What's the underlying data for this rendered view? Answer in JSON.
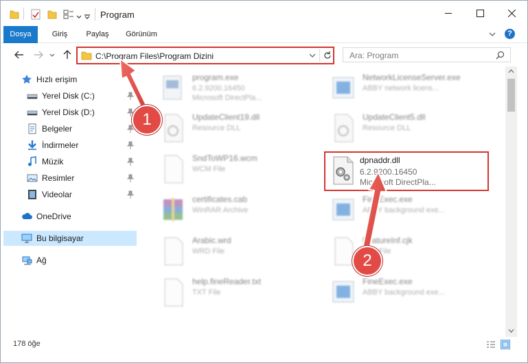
{
  "window": {
    "title": "Program",
    "controls": [
      "minimize-icon",
      "maximize-icon",
      "close-icon"
    ]
  },
  "ribbon": {
    "tabs": [
      {
        "label": "Dosya",
        "active": true
      },
      {
        "label": "Giriş"
      },
      {
        "label": "Paylaş"
      },
      {
        "label": "Görünüm"
      }
    ],
    "help_label": "?"
  },
  "nav": {
    "address": "C:\\Program Files\\Program Dizini",
    "search_placeholder": "Ara: Program"
  },
  "sidebar": {
    "items": [
      {
        "label": "Hızlı erişim",
        "icon": "star-icon"
      },
      {
        "label": "Yerel Disk (C:)",
        "icon": "drive-icon",
        "pinned": true
      },
      {
        "label": "Yerel Disk (D:)",
        "icon": "drive-icon",
        "pinned": true
      },
      {
        "label": "Belgeler",
        "icon": "documents-icon",
        "pinned": true
      },
      {
        "label": "İndirmeler",
        "icon": "download-icon",
        "pinned": true
      },
      {
        "label": "Müzik",
        "icon": "music-icon",
        "pinned": true
      },
      {
        "label": "Resimler",
        "icon": "pictures-icon",
        "pinned": true
      },
      {
        "label": "Videolar",
        "icon": "videos-icon",
        "pinned": true
      },
      {
        "label": "OneDrive",
        "icon": "cloud-icon"
      },
      {
        "label": "Bu bilgisayar",
        "icon": "computer-icon",
        "selected": true
      },
      {
        "label": "Ağ",
        "icon": "network-icon"
      }
    ]
  },
  "files": [
    {
      "name": "program.exe",
      "line2": "6.2.9200.16450",
      "line3": "Microsoft DirectPla...",
      "icon": "exe-icon"
    },
    {
      "name": "NetworkLicenseServer.exe",
      "line2": "ABBY network licens...",
      "line3": "",
      "icon": "app-blue-icon"
    },
    {
      "name": "UpdateClient19.dll",
      "line2": "Resource DLL",
      "line3": "",
      "icon": "dll-icon"
    },
    {
      "name": "UpdateClient5.dll",
      "line2": "Resource DLL",
      "line3": "",
      "icon": "dll-icon"
    },
    {
      "name": "SndToWP16.wcm",
      "line2": "WCM File",
      "line3": "",
      "icon": "blank-file-icon"
    },
    {
      "name": "dpnaddr.dll",
      "line2": "6.2.9200.16450",
      "line3": "Microsoft DirectPla...",
      "icon": "dll-gear-icon",
      "highlighted": true
    },
    {
      "name": "certificates.cab",
      "line2": "WinRAR Archive",
      "line3": "",
      "icon": "archive-icon"
    },
    {
      "name": "FineExec.exe",
      "line2": "ABBY background exe...",
      "line3": "",
      "icon": "app-blue-icon"
    },
    {
      "name": "Arabic.wrd",
      "line2": "WRD File",
      "line3": "",
      "icon": "blank-file-icon"
    },
    {
      "name": "FeatureInf.cjk",
      "line2": "CJK File",
      "line3": "",
      "icon": "blank-file-icon"
    },
    {
      "name": "help.fineReader.txt",
      "line2": "TXT File",
      "line3": "",
      "icon": "blank-file-icon"
    },
    {
      "name": "FineExec.exe",
      "line2": "ABBY background exe...",
      "line3": "",
      "icon": "app-blue-icon"
    }
  ],
  "status": {
    "item_count": "178 öğe"
  },
  "callouts": {
    "one": "1",
    "two": "2"
  },
  "colors": {
    "accent": "#1979ca",
    "highlight_red": "#d4342e",
    "badge_red": "#e24a45",
    "selection": "#cce8ff"
  }
}
